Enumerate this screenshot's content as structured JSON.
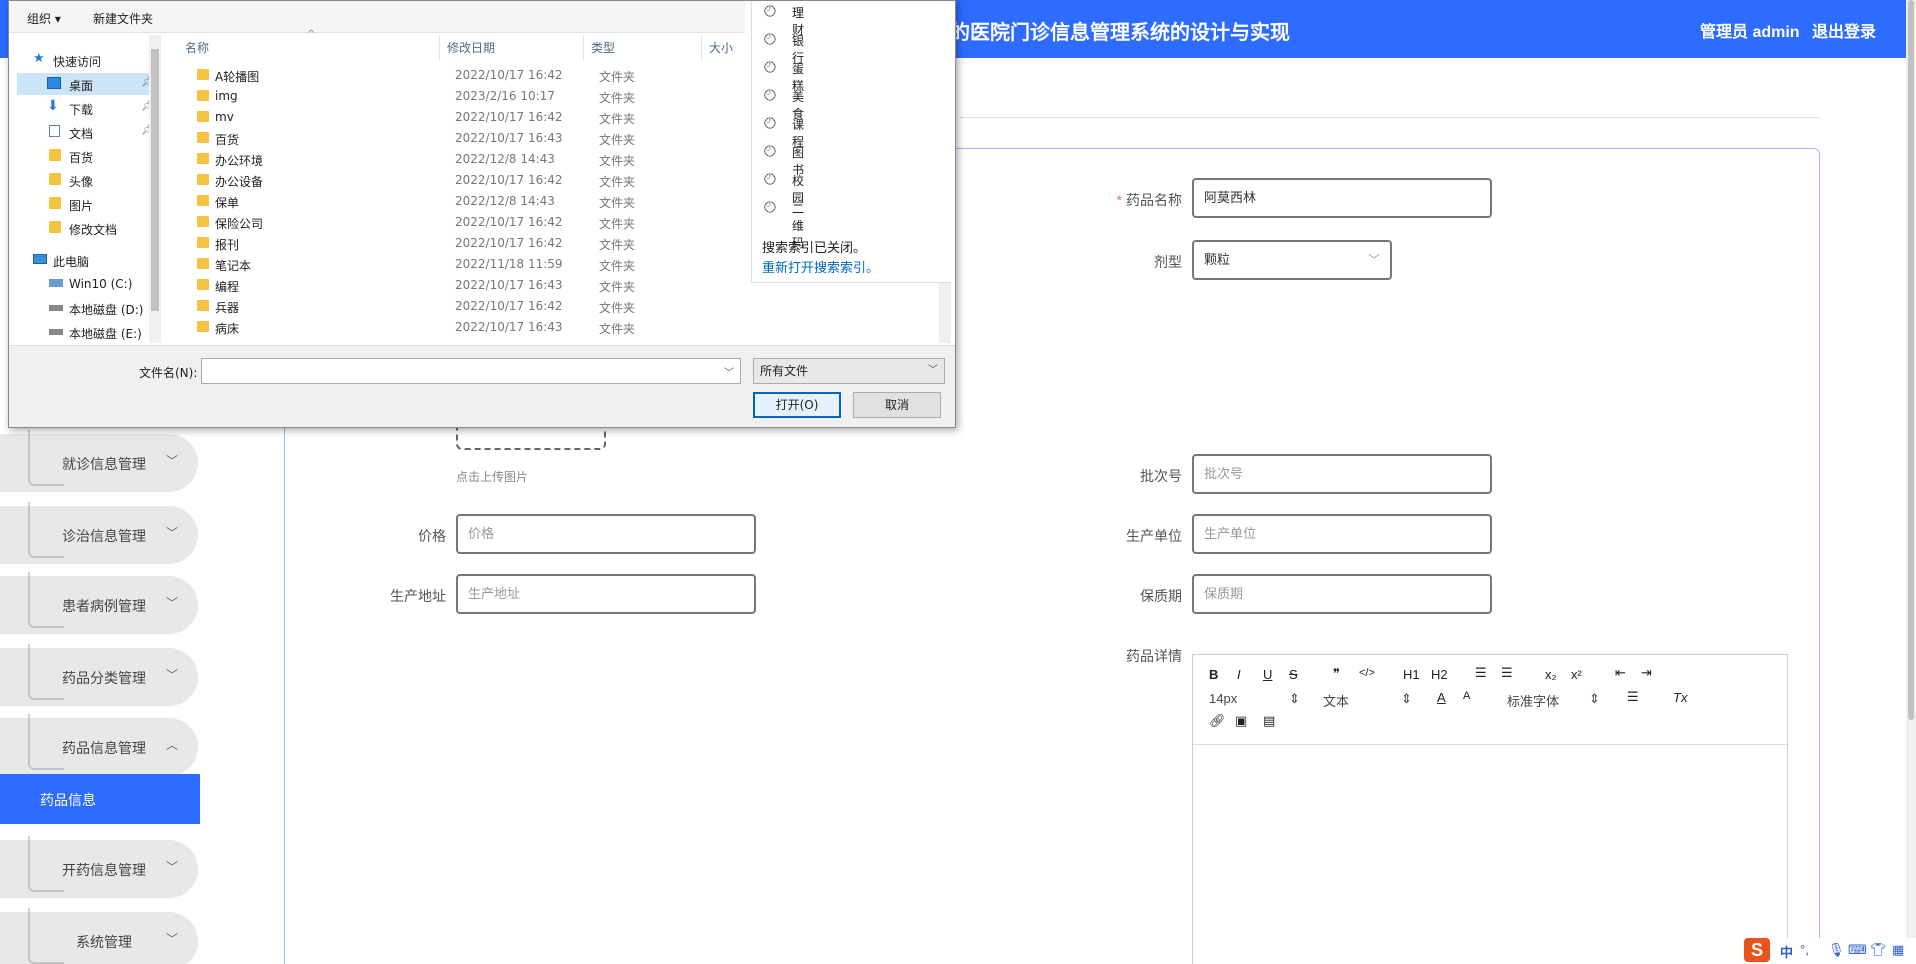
{
  "header": {
    "title": "的医院门诊信息管理系统的设计与实现",
    "admin_label": "管理员 admin",
    "logout_label": "退出登录"
  },
  "sidebar": {
    "items": [
      {
        "label": "就诊信息管理",
        "chevron": "chevron-down-icon"
      },
      {
        "label": "诊治信息管理",
        "chevron": "chevron-down-icon"
      },
      {
        "label": "患者病例管理",
        "chevron": "chevron-down-icon"
      },
      {
        "label": "药品分类管理",
        "chevron": "chevron-down-icon"
      },
      {
        "label": "药品信息管理",
        "chevron": "chevron-up-icon"
      }
    ],
    "active_item": "药品信息",
    "items_after": [
      {
        "label": "开药信息管理",
        "chevron": "chevron-down-icon"
      },
      {
        "label": "系统管理",
        "chevron": "chevron-down-icon"
      }
    ]
  },
  "form": {
    "drug_name": {
      "label": "药品名称",
      "value": "阿莫西林"
    },
    "dosage_form": {
      "label": "剂型",
      "value": "颗粒"
    },
    "upload_hint": "点击上传图片",
    "batch_no": {
      "label": "批次号",
      "placeholder": "批次号"
    },
    "price": {
      "label": "价格",
      "placeholder": "价格"
    },
    "manufacturer": {
      "label": "生产单位",
      "placeholder": "生产单位"
    },
    "address": {
      "label": "生产地址",
      "placeholder": "生产地址"
    },
    "shelf_life": {
      "label": "保质期",
      "placeholder": "保质期"
    },
    "details": {
      "label": "药品详情"
    }
  },
  "editor": {
    "font_size": "14px",
    "paragraph": "文本",
    "font_family": "标准字体",
    "buttons": {
      "bold": "B",
      "italic": "I",
      "underline": "U",
      "strike": "S",
      "quote": "❞",
      "code": "</>",
      "h1": "H1",
      "h2": "H2",
      "sub": "x₂",
      "sup": "x²",
      "font_color": "A",
      "bg_color": "A",
      "clear": "Tx"
    }
  },
  "dialog": {
    "toolbar": {
      "organize": "组织 ▾",
      "new_folder": "新建文件夹"
    },
    "nav": {
      "quick_access": "快速访问",
      "items": [
        "桌面",
        "下载",
        "文档",
        "百货",
        "头像",
        "图片",
        "修改文档"
      ],
      "this_pc": "此电脑",
      "drives": [
        "Win10 (C:)",
        "本地磁盘 (D:)",
        "本地磁盘 (E:)"
      ]
    },
    "columns": {
      "name": "名称",
      "date": "修改日期",
      "type": "类型",
      "size": "大小"
    },
    "rows": [
      {
        "name": "A轮播图",
        "date": "2022/10/17 16:42",
        "type": "文件夹"
      },
      {
        "name": "img",
        "date": "2023/2/16 10:17",
        "type": "文件夹"
      },
      {
        "name": "mv",
        "date": "2022/10/17 16:42",
        "type": "文件夹"
      },
      {
        "name": "百货",
        "date": "2022/10/17 16:43",
        "type": "文件夹"
      },
      {
        "name": "办公环境",
        "date": "2022/12/8 14:43",
        "type": "文件夹"
      },
      {
        "name": "办公设备",
        "date": "2022/10/17 16:42",
        "type": "文件夹"
      },
      {
        "name": "保单",
        "date": "2022/12/8 14:43",
        "type": "文件夹"
      },
      {
        "name": "保险公司",
        "date": "2022/10/17 16:42",
        "type": "文件夹"
      },
      {
        "name": "报刊",
        "date": "2022/10/17 16:42",
        "type": "文件夹"
      },
      {
        "name": "笔记本",
        "date": "2022/11/18 11:59",
        "type": "文件夹"
      },
      {
        "name": "编程",
        "date": "2022/10/17 16:43",
        "type": "文件夹"
      },
      {
        "name": "兵器",
        "date": "2022/10/17 16:42",
        "type": "文件夹"
      },
      {
        "name": "病床",
        "date": "2022/10/17 16:43",
        "type": "文件夹"
      }
    ],
    "history": [
      "理财",
      "银行",
      "蛋糕",
      "美食",
      "课程",
      "图书",
      "校园",
      "二维码"
    ],
    "history_note": "搜索索引已关闭。",
    "history_link": "重新打开搜索索引。",
    "filename_label": "文件名(N):",
    "filetype": "所有文件",
    "open_button": "打开(O)",
    "cancel_button": "取消"
  },
  "ime": {
    "logo": "S",
    "lang": "中",
    "punct": "°,"
  }
}
